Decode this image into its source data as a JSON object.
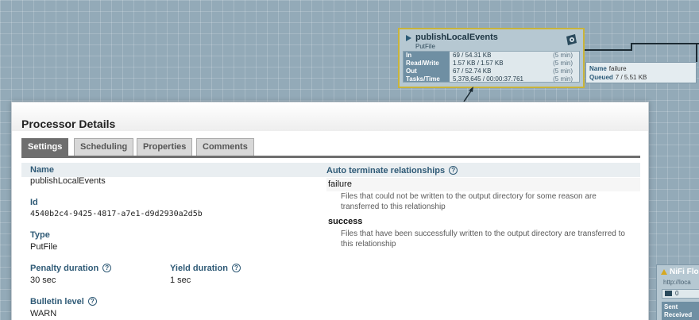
{
  "canvas": {
    "processor": {
      "name": "publishLocalEvents",
      "type": "PutFile",
      "stats": [
        {
          "label": "In",
          "value": "69 / 54.31 KB",
          "window": "(5 min)"
        },
        {
          "label": "Read/Write",
          "value": "1.57 KB / 1.57 KB",
          "window": "(5 min)"
        },
        {
          "label": "Out",
          "value": "67 / 52.74 KB",
          "window": "(5 min)"
        },
        {
          "label": "Tasks/Time",
          "value": "5,378,645 / 00:00:37.761",
          "window": "(5 min)"
        }
      ]
    },
    "connection": {
      "name_label": "Name",
      "name_value": "failure",
      "queued_label": "Queued",
      "queued_value": "7 / 5.51 KB"
    },
    "remote_group": {
      "name": "NiFi Flo",
      "url": "http://loca",
      "count": "0",
      "sent_label": "Sent",
      "received_label": "Received"
    }
  },
  "dialog": {
    "title": "Processor Details",
    "tabs": [
      {
        "label": "Settings",
        "active": true
      },
      {
        "label": "Scheduling",
        "active": false
      },
      {
        "label": "Properties",
        "active": false
      },
      {
        "label": "Comments",
        "active": false
      }
    ],
    "settings": {
      "name_label": "Name",
      "name_value": "publishLocalEvents",
      "id_label": "Id",
      "id_value": "4540b2c4-9425-4817-a7e1-d9d2930a2d5b",
      "type_label": "Type",
      "type_value": "PutFile",
      "penalty_label": "Penalty duration",
      "penalty_value": "30 sec",
      "yield_label": "Yield duration",
      "yield_value": "1 sec",
      "bulletin_label": "Bulletin level",
      "bulletin_value": "WARN",
      "auto_terminate_label": "Auto terminate relationships",
      "help_glyph": "?",
      "relationships": [
        {
          "name": "failure",
          "description": "Files that could not be written to the output directory for some reason are transferred to this relationship"
        },
        {
          "name": "success",
          "description": "Files that have been successfully written to the output directory are transferred to this relationship"
        }
      ]
    }
  }
}
